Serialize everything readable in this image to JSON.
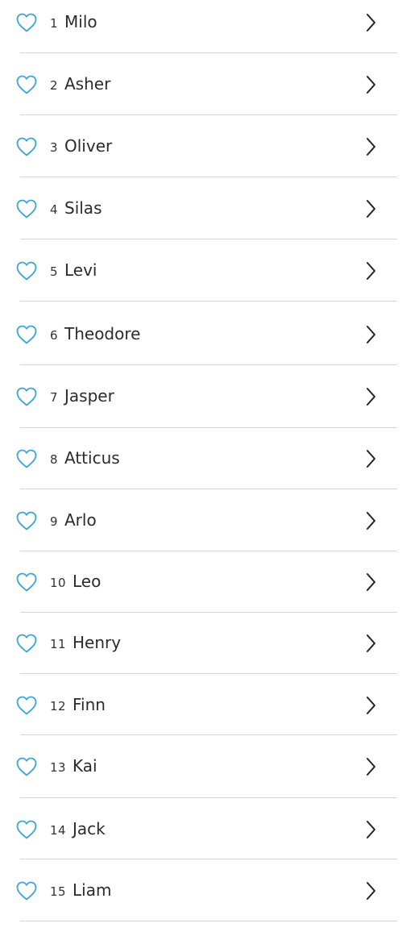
{
  "colors": {
    "heart": "#3aa6d8",
    "text": "#2b2b2b",
    "divider": "#d4d4d4",
    "chevron": "#222222"
  },
  "icons": {
    "favorite": "heart-outline-icon",
    "open": "chevron-right-icon"
  },
  "names": [
    {
      "rank": "1",
      "name": "Milo"
    },
    {
      "rank": "2",
      "name": "Asher"
    },
    {
      "rank": "3",
      "name": "Oliver"
    },
    {
      "rank": "4",
      "name": "Silas"
    },
    {
      "rank": "5",
      "name": "Levi"
    },
    {
      "rank": "6",
      "name": "Theodore"
    },
    {
      "rank": "7",
      "name": "Jasper"
    },
    {
      "rank": "8",
      "name": "Atticus"
    },
    {
      "rank": "9",
      "name": "Arlo"
    },
    {
      "rank": "10",
      "name": "Leo"
    },
    {
      "rank": "11",
      "name": "Henry"
    },
    {
      "rank": "12",
      "name": "Finn"
    },
    {
      "rank": "13",
      "name": "Kai"
    },
    {
      "rank": "14",
      "name": "Jack"
    },
    {
      "rank": "15",
      "name": "Liam"
    }
  ]
}
